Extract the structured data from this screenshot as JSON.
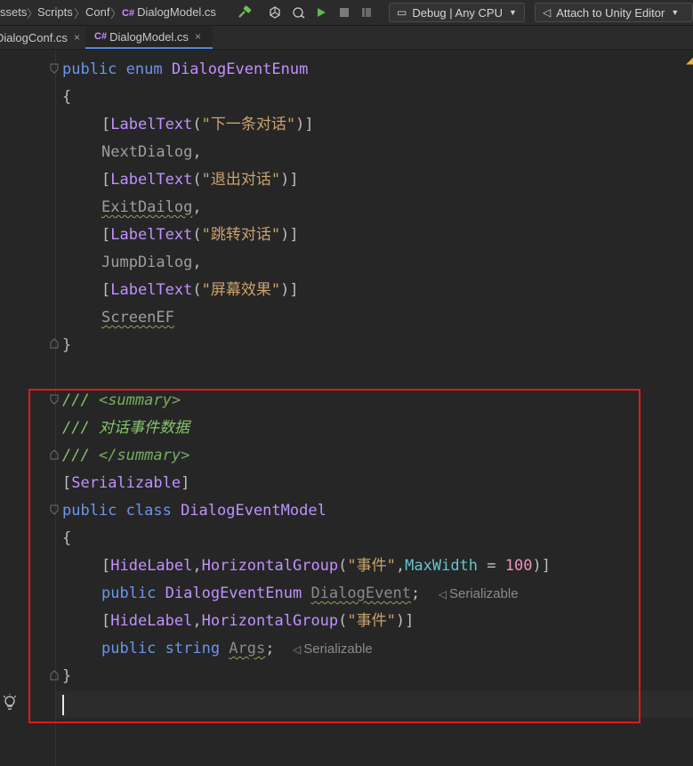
{
  "breadcrumb": {
    "items": [
      "ssets",
      "Scripts",
      "Conf",
      "DialogModel.cs"
    ],
    "file_badge": "C#"
  },
  "toolbar": {
    "config_dropdown": "Debug | Any CPU",
    "attach_dropdown": "Attach to Unity Editor"
  },
  "tabs": [
    {
      "label": "DialogConf.cs",
      "badge": "",
      "close": "×"
    },
    {
      "label": "DialogModel.cs",
      "badge": "C#",
      "close": "×"
    }
  ],
  "code": {
    "l1_kw": "public enum ",
    "l1_name": "DialogEventEnum",
    "open_brace": "{",
    "close_brace": "}",
    "attr_name": "LabelText",
    "enum_items": [
      {
        "label": "\"下一条对话\"",
        "member": "NextDialog",
        "suffix": ","
      },
      {
        "label": "\"退出对话\"",
        "member": "ExitDailog",
        "suffix": ","
      },
      {
        "label": "\"跳转对话\"",
        "member": "JumpDialog",
        "suffix": ","
      },
      {
        "label": "\"屏幕效果\"",
        "member": "ScreenEF",
        "suffix": ""
      }
    ],
    "summary_prefix": "/// ",
    "summary_open": "<summary>",
    "summary_text": "对话事件数据",
    "summary_close": "</summary>",
    "serializable_attr": "Serializable",
    "class_kw": "public class ",
    "class_name": "DialogEventModel",
    "hide_label": "HideLabel",
    "horizontal_group": "HorizontalGroup",
    "group_arg": "\"事件\"",
    "max_width_name": "MaxWidth",
    "max_width_value": "100",
    "field1_kw": "public ",
    "field1_type": "DialogEventEnum",
    "field1_name": "DialogEvent",
    "field2_kw": "public string ",
    "field2_name": "Args",
    "hint_text": "Serializable"
  },
  "colors": {
    "annotation_box": "#e01a1a",
    "keyword": "#6c95eb",
    "type": "#c191ff",
    "string": "#c9a26d",
    "comment": "#85c46c"
  }
}
